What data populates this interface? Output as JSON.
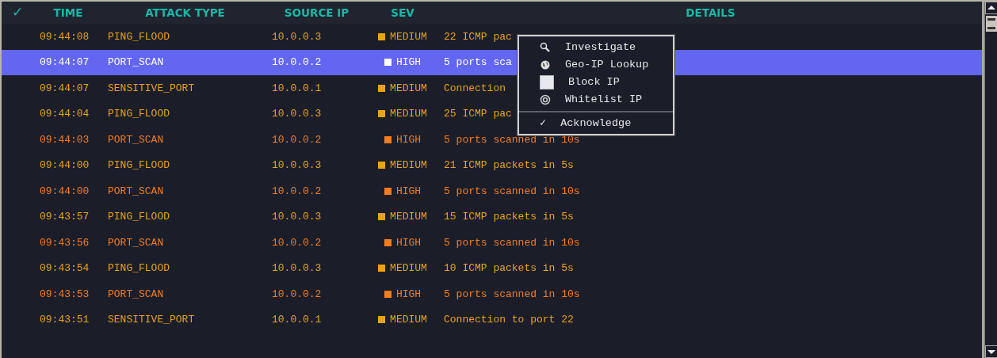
{
  "table": {
    "columns": [
      "✓",
      "TIME",
      "ATTACK TYPE",
      "SOURCE IP",
      "SEV",
      "DETAILS"
    ],
    "rows": [
      {
        "time": "09:44:08",
        "attack_type": "PING_FLOOD",
        "source_ip": "10.0.0.3",
        "sev": "MEDIUM",
        "kind": "medium",
        "details": "22 ICMP pac",
        "selected": false
      },
      {
        "time": "09:44:07",
        "attack_type": "PORT_SCAN",
        "source_ip": "10.0.0.2",
        "sev": "HIGH",
        "kind": "high",
        "details": "5 ports sca",
        "selected": true
      },
      {
        "time": "09:44:07",
        "attack_type": "SENSITIVE_PORT",
        "source_ip": "10.0.0.1",
        "sev": "MEDIUM",
        "kind": "medium",
        "details": "Connection",
        "selected": false
      },
      {
        "time": "09:44:04",
        "attack_type": "PING_FLOOD",
        "source_ip": "10.0.0.3",
        "sev": "MEDIUM",
        "kind": "medium",
        "details": "25 ICMP pac",
        "selected": false
      },
      {
        "time": "09:44:03",
        "attack_type": "PORT_SCAN",
        "source_ip": "10.0.0.2",
        "sev": "HIGH",
        "kind": "high",
        "details": "5 ports scanned in 10s",
        "selected": false
      },
      {
        "time": "09:44:00",
        "attack_type": "PING_FLOOD",
        "source_ip": "10.0.0.3",
        "sev": "MEDIUM",
        "kind": "medium",
        "details": "21 ICMP packets in 5s",
        "selected": false
      },
      {
        "time": "09:44:00",
        "attack_type": "PORT_SCAN",
        "source_ip": "10.0.0.2",
        "sev": "HIGH",
        "kind": "high",
        "details": "5 ports scanned in 10s",
        "selected": false
      },
      {
        "time": "09:43:57",
        "attack_type": "PING_FLOOD",
        "source_ip": "10.0.0.3",
        "sev": "MEDIUM",
        "kind": "medium",
        "details": "15 ICMP packets in 5s",
        "selected": false
      },
      {
        "time": "09:43:56",
        "attack_type": "PORT_SCAN",
        "source_ip": "10.0.0.2",
        "sev": "HIGH",
        "kind": "high",
        "details": "5 ports scanned in 10s",
        "selected": false
      },
      {
        "time": "09:43:54",
        "attack_type": "PING_FLOOD",
        "source_ip": "10.0.0.3",
        "sev": "MEDIUM",
        "kind": "medium",
        "details": "10 ICMP packets in 5s",
        "selected": false
      },
      {
        "time": "09:43:53",
        "attack_type": "PORT_SCAN",
        "source_ip": "10.0.0.2",
        "sev": "HIGH",
        "kind": "high",
        "details": "5 ports scanned in 10s",
        "selected": false
      },
      {
        "time": "09:43:51",
        "attack_type": "SENSITIVE_PORT",
        "source_ip": "10.0.0.1",
        "sev": "MEDIUM",
        "kind": "medium",
        "details": "Connection to port 22",
        "selected": false
      }
    ]
  },
  "context_menu": {
    "items": [
      {
        "kind": "search",
        "label": "Investigate"
      },
      {
        "kind": "globe",
        "label": "Geo-IP Lookup"
      },
      {
        "kind": "block",
        "label": "Block IP"
      },
      {
        "kind": "target",
        "label": "Whitelist IP"
      },
      {
        "kind": "separator"
      },
      {
        "kind": "glyph",
        "glyph": "✓",
        "label": "Acknowledge"
      }
    ]
  }
}
